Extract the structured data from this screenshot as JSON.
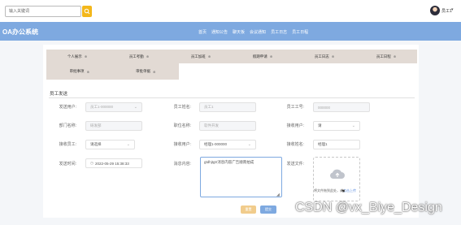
{
  "search": {
    "placeholder": "输入关键词"
  },
  "user": {
    "name": "员工1",
    "caret": "▾"
  },
  "brand": {
    "title": "OA办公系统"
  },
  "nav": {
    "items": [
      "首页",
      "通知公告",
      "聊天板",
      "会议通知",
      "员工日志",
      "员工日程"
    ]
  },
  "tabs": {
    "row1": [
      "个人展示",
      "员工考勤",
      "员工加班",
      "假期申请",
      "员工日志",
      "员工日程"
    ],
    "row2": [
      "审批事项",
      "审批单据"
    ],
    "icon_glyph": "⊕"
  },
  "form": {
    "section_title": "员工发送",
    "fields": {
      "sender": {
        "label": "发送用户:",
        "value": "员工1-000000"
      },
      "employee_name": {
        "label": "员工姓名:",
        "value": "员工1"
      },
      "employee_no": {
        "label": "员工工号:",
        "value": "000000"
      },
      "department": {
        "label": "部门名称:",
        "value": "研发部"
      },
      "position": {
        "label": "职位名称:",
        "value": "软件开发"
      },
      "receiver_user": {
        "label": "接收用户:",
        "value": "请"
      },
      "receiver_staff": {
        "label": "接收员工:",
        "value": "请选择"
      },
      "receiver_user2": {
        "label": "接收用户:",
        "value": "经理1-000000"
      },
      "receiver_name": {
        "label": "接收姓名:",
        "value": "经理1"
      },
      "send_time": {
        "label": "发送时间:",
        "value": "2022-05-29 15:38:33"
      },
      "message": {
        "label": "消息内容:",
        "value": "gtdhjtgtr消息内容广告顺南拍成"
      },
      "file": {
        "label": "发送文件:"
      }
    },
    "upload_hint_prefix": "将文件拖到此处，或",
    "upload_hint_link": "点击上传",
    "reset_label": "重置",
    "submit_label": "提交"
  },
  "watermark": "CSDN @vx_Biye_Design",
  "colors": {
    "navbar": "#7ea9e0",
    "search_button": "#f3b71b",
    "tab_bar": "#e2dad4",
    "submit": "#7ea9e0",
    "reset": "#f1cc8c"
  }
}
